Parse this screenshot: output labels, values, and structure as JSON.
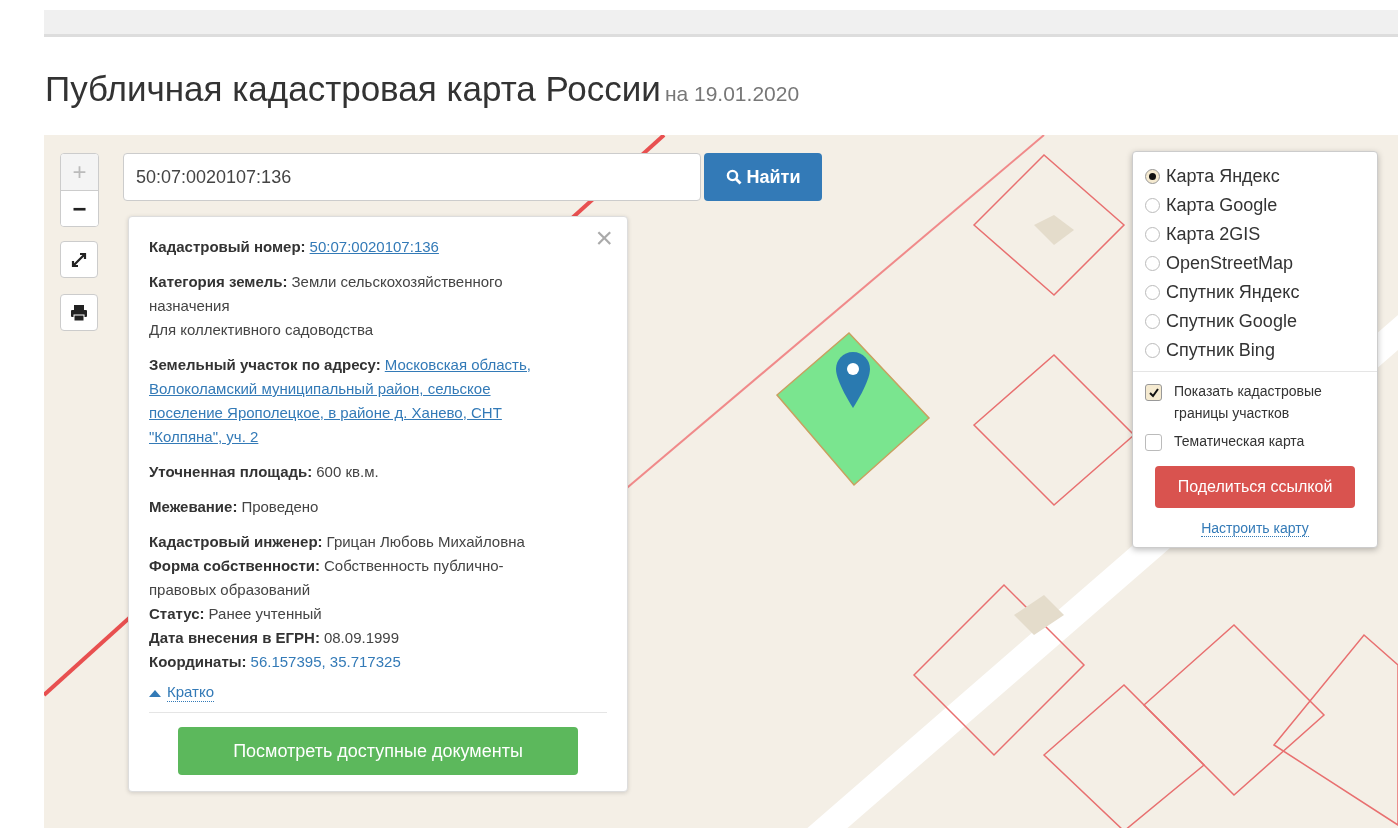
{
  "title": "Публичная кадастровая карта России",
  "date": "на 19.01.2020",
  "zoom": {
    "in": {
      "label": "+",
      "disabled": true
    },
    "out": {
      "label": "−",
      "disabled": false
    }
  },
  "search": {
    "value": "50:07:0020107:136",
    "button": "Найти"
  },
  "info": {
    "close": "×",
    "sections": [
      [
        {
          "label": "Кадастровый номер:",
          "value": "50:07:0020107:136",
          "kind": "link"
        }
      ],
      [
        {
          "label": "Категория земель:",
          "value": "Земли сельскохозяйственного",
          "more": [
            "назначения"
          ],
          "kind": "text",
          "note": "Для коллективного садоводства"
        }
      ],
      [
        {
          "label": "Земельный участок по адресу:",
          "value": "Московская область,",
          "more": [
            "Волоколамский муниципальный район, сельское",
            "поселение Ярополецкое, в районе д. Ханево, СНТ",
            "\"Колпяна\", уч. 2"
          ],
          "kind": "link"
        }
      ],
      [
        {
          "label": "Уточненная площадь:",
          "value": "600 кв.м.",
          "kind": "text"
        }
      ],
      [
        {
          "label": "Межевание:",
          "value": "Проведено",
          "kind": "text"
        }
      ],
      [
        {
          "label": "Кадастровый инженер:",
          "value": "Грицан Любовь Михайловна",
          "kind": "text"
        },
        {
          "label": "Форма собственности:",
          "value": "Собственность публично-",
          "more": [
            "правовых образований"
          ],
          "kind": "text"
        },
        {
          "label": "Статус:",
          "value": "Ранее учтенный",
          "kind": "text"
        },
        {
          "label": "Дата внесения в ЕГРН:",
          "value": "08.09.1999",
          "kind": "text"
        },
        {
          "label": "Координаты:",
          "value": "56.157395, 35.717325",
          "kind": "coords"
        }
      ]
    ],
    "toggle": "Кратко",
    "button": "Посмотреть доступные документы"
  },
  "layers": [
    {
      "label": "Карта Яндекс",
      "selected": true
    },
    {
      "label": "Карта Google",
      "selected": false
    },
    {
      "label": "Карта 2GIS",
      "selected": false
    },
    {
      "label": "OpenStreetMap",
      "selected": false
    },
    {
      "label": "Спутник Яндекс",
      "selected": false
    },
    {
      "label": "Спутник Google",
      "selected": false
    },
    {
      "label": "Спутник Bing",
      "selected": false
    }
  ],
  "options": [
    {
      "label": "Показать кадастровые границы участков",
      "checked": true
    },
    {
      "label": "Тематическая карта",
      "checked": false
    }
  ],
  "share": "Поделиться ссылкой",
  "configure": "Настроить карту"
}
